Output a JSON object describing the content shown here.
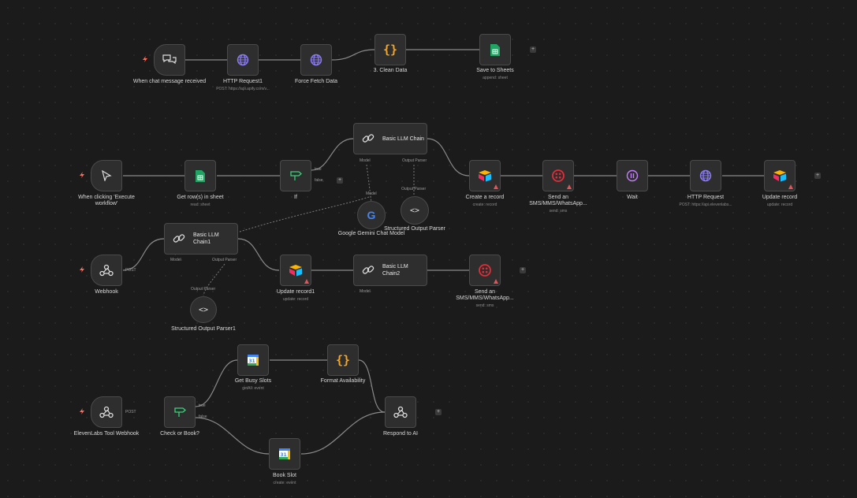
{
  "colors": {
    "canvas": "#1b1b1b",
    "node": "#2e2e2e",
    "edge": "#8a8a8a",
    "trigger_bolt": "#ff6d5a",
    "http": "#7b68ee",
    "code": "#f5a623",
    "sheets": "#1fa463",
    "if": "#3ed07d",
    "airtable_blue": "#18bfff",
    "twilio": "#e12d39",
    "wait": "#c77dff",
    "warning": "#e0555a"
  },
  "workflow_1": {
    "chat_trigger": {
      "label": "When chat message received",
      "icon": "chat-icon"
    },
    "http_request_1": {
      "label": "HTTP Request1",
      "sub": "POST: https://api.apify.com/v..."
    },
    "force_fetch": {
      "label": "Force Fetch Data"
    },
    "clean_data": {
      "label": "3. Clean Data"
    },
    "save_sheets": {
      "label": "Save to Sheets",
      "sub": "append: sheet"
    }
  },
  "workflow_2": {
    "manual_trigger": {
      "label": "When clicking 'Execute workflow'"
    },
    "get_rows": {
      "label": "Get row(s) in sheet",
      "sub": "read: sheet"
    },
    "if_node": {
      "label": "If",
      "true_label": "true",
      "false_label": "false"
    },
    "llm_chain": {
      "label": "Basic LLM Chain",
      "model_port": "Model",
      "parser_port": "Output Parser"
    },
    "gemini": {
      "label": "Google Gemini Chat Model",
      "port": "Model"
    },
    "parser": {
      "label": "Structured Output Parser",
      "port": "Output Parser"
    },
    "create_record": {
      "label": "Create a record",
      "sub": "create: record"
    },
    "send_sms": {
      "label": "Send an SMS/MMS/WhatsApp...",
      "sub": "send: sms"
    },
    "wait": {
      "label": "Wait"
    },
    "http_request": {
      "label": "HTTP Request",
      "sub": "POST: https://api.elevenlabs..."
    },
    "update_record": {
      "label": "Update record",
      "sub": "update: record"
    }
  },
  "workflow_3": {
    "webhook": {
      "label": "Webhook",
      "method": "POST"
    },
    "llm_chain_1": {
      "label": "Basic LLM Chain1",
      "model_port": "Model",
      "parser_port": "Output Parser"
    },
    "parser_1": {
      "label": "Structured Output Parser1",
      "port": "Output Parser"
    },
    "update_record_1": {
      "label": "Update record1",
      "sub": "update: record"
    },
    "llm_chain_2": {
      "label": "Basic LLM Chain2",
      "model_port": "Model"
    },
    "send_sms_1": {
      "label": "Send an SMS/MMS/WhatsApp...",
      "sub": "send: sms"
    }
  },
  "workflow_4": {
    "el_webhook": {
      "label": "ElevenLabs Tool Webhook",
      "method": "POST"
    },
    "check_or_book": {
      "label": "Check or Book?",
      "true_label": "true",
      "false_label": "false"
    },
    "get_busy": {
      "label": "Get Busy Slots",
      "sub": "getAll: event"
    },
    "format_avail": {
      "label": "Format Availability"
    },
    "book_slot": {
      "label": "Book Slot",
      "sub": "create: event"
    },
    "respond_ai": {
      "label": "Respond to AI"
    }
  },
  "plus_sign": "+"
}
